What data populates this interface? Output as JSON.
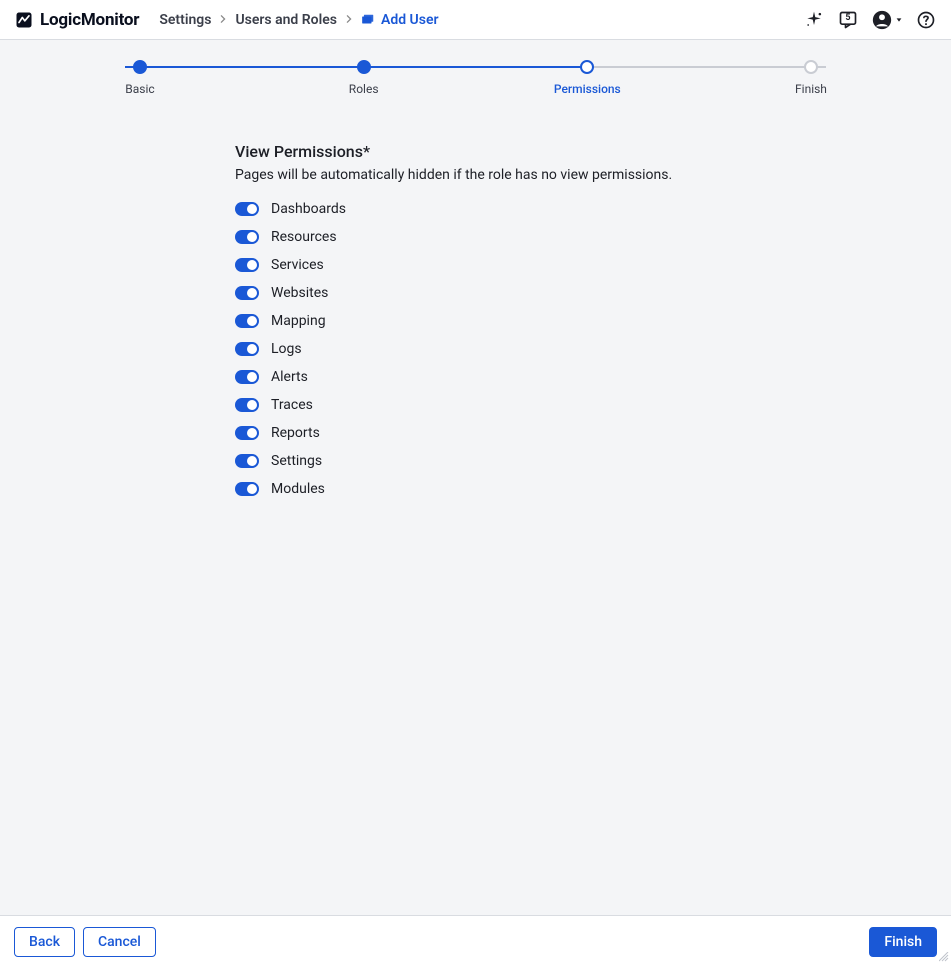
{
  "brand": "LogicMonitor",
  "breadcrumbs": {
    "settings": "Settings",
    "users_roles": "Users and Roles",
    "current": "Add User"
  },
  "header_badge": "5",
  "stepper": {
    "steps": [
      {
        "label": "Basic",
        "state": "filled"
      },
      {
        "label": "Roles",
        "state": "filled"
      },
      {
        "label": "Permissions",
        "state": "current"
      },
      {
        "label": "Finish",
        "state": "inactive"
      }
    ]
  },
  "section": {
    "title": "View Permissions*",
    "description": "Pages will be automatically hidden if the role has no view permissions."
  },
  "permissions": [
    {
      "label": "Dashboards",
      "on": true
    },
    {
      "label": "Resources",
      "on": true
    },
    {
      "label": "Services",
      "on": true
    },
    {
      "label": "Websites",
      "on": true
    },
    {
      "label": "Mapping",
      "on": true
    },
    {
      "label": "Logs",
      "on": true
    },
    {
      "label": "Alerts",
      "on": true
    },
    {
      "label": "Traces",
      "on": true
    },
    {
      "label": "Reports",
      "on": true
    },
    {
      "label": "Settings",
      "on": true
    },
    {
      "label": "Modules",
      "on": true
    }
  ],
  "footer": {
    "back": "Back",
    "cancel": "Cancel",
    "finish": "Finish"
  }
}
